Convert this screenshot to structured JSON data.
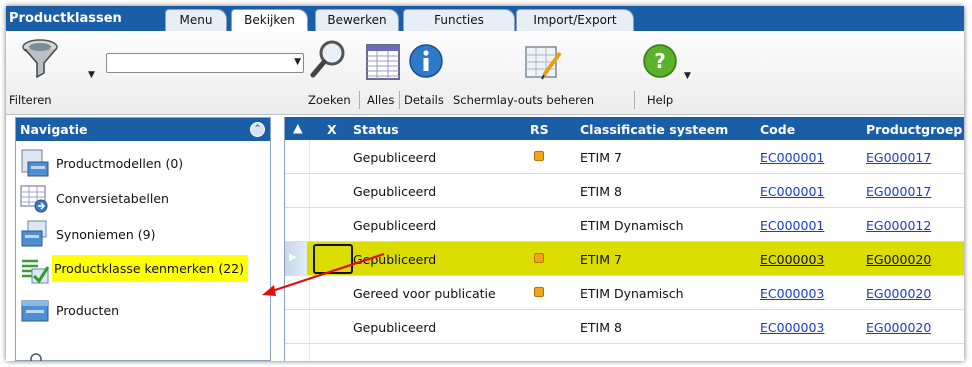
{
  "app": {
    "title": "Productklassen"
  },
  "tabs": [
    {
      "label": "Menu"
    },
    {
      "label": "Bekijken"
    },
    {
      "label": "Bewerken"
    },
    {
      "label": "Functies"
    },
    {
      "label": "Import/Export"
    }
  ],
  "toolbar": {
    "filter_label": "Filteren",
    "search_value": "",
    "zoeken_label": "Zoeken",
    "alles_label": "Alles",
    "details_label": "Details",
    "schermlay_label": "Schermlay-outs beheren",
    "help_label": "Help"
  },
  "nav": {
    "title": "Navigatie",
    "items": [
      {
        "label": "Productmodellen (0)",
        "icon": "product-model-icon"
      },
      {
        "label": "Conversietabellen",
        "icon": "conversion-table-icon"
      },
      {
        "label": "Synoniemen (9)",
        "icon": "synonym-icon"
      },
      {
        "label": "Productklasse kenmerken (22)",
        "icon": "feature-list-check-icon",
        "highlight_color": "#ffff00"
      },
      {
        "label": "Producten",
        "icon": "products-icon"
      }
    ]
  },
  "grid": {
    "columns": [
      "X",
      "Status",
      "RS",
      "Classificatie systeem",
      "Code",
      "Productgroep"
    ],
    "rows": [
      {
        "status": "Gepubliceerd",
        "rs": true,
        "system": "ETIM 7",
        "code": "EC000001",
        "group": "EG000017"
      },
      {
        "status": "Gepubliceerd",
        "rs": false,
        "system": "ETIM 8",
        "code": "EC000001",
        "group": "EG000017"
      },
      {
        "status": "Gepubliceerd",
        "rs": false,
        "system": "ETIM Dynamisch",
        "code": "EC000001",
        "group": "EG000012"
      },
      {
        "status": "Gepubliceerd",
        "rs": true,
        "system": "ETIM 7",
        "code": "EC000003",
        "group": "EG000020",
        "selected": true
      },
      {
        "status": "Gereed voor publicatie",
        "rs": true,
        "system": "ETIM Dynamisch",
        "code": "EC000003",
        "group": "EG000020"
      },
      {
        "status": "Gepubliceerd",
        "rs": false,
        "system": "ETIM 8",
        "code": "EC000003",
        "group": "EG000020"
      }
    ],
    "rs_color": "#f2a617",
    "selected_row_color": "#dbdc00"
  },
  "colors": {
    "header_blue": "#1b5ea8",
    "link_blue": "#1a3dc8",
    "annotation_arrow": "#e01010"
  }
}
